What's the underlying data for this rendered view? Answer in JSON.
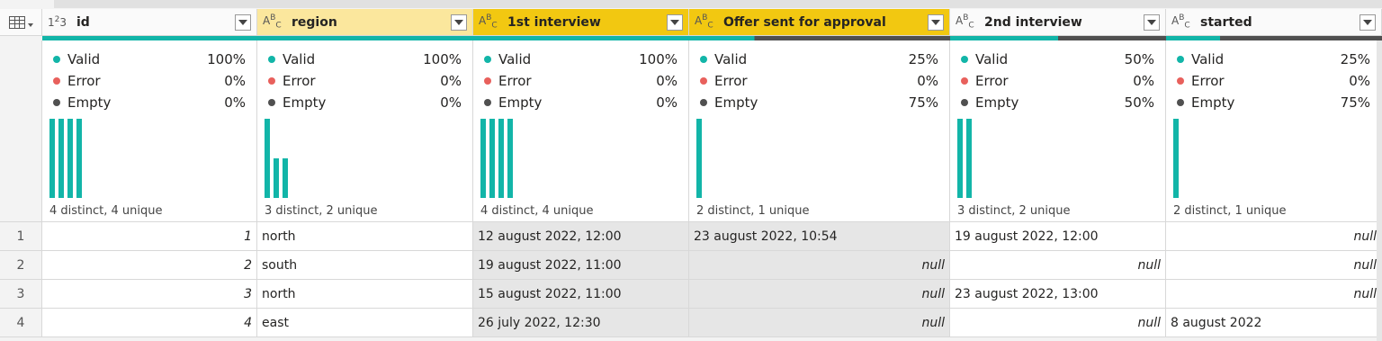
{
  "columns": [
    {
      "name": "id",
      "type": "123",
      "profile": {
        "valid": "100%",
        "error": "0%",
        "empty": "0%",
        "distinct": "4 distinct, 4 unique",
        "valid_fraction": 1.0
      }
    },
    {
      "name": "region",
      "type": "ABC",
      "profile": {
        "valid": "100%",
        "error": "0%",
        "empty": "0%",
        "distinct": "3 distinct, 2 unique",
        "valid_fraction": 1.0
      }
    },
    {
      "name": "1st interview",
      "type": "ABC",
      "profile": {
        "valid": "100%",
        "error": "0%",
        "empty": "0%",
        "distinct": "4 distinct, 4 unique",
        "valid_fraction": 1.0
      }
    },
    {
      "name": "Offer sent for approval",
      "type": "ABC",
      "profile": {
        "valid": "25%",
        "error": "0%",
        "empty": "75%",
        "distinct": "2 distinct, 1 unique",
        "valid_fraction": 0.25
      }
    },
    {
      "name": "2nd interview",
      "type": "ABC",
      "profile": {
        "valid": "50%",
        "error": "0%",
        "empty": "50%",
        "distinct": "3 distinct, 2 unique",
        "valid_fraction": 0.5
      }
    },
    {
      "name": "started",
      "type": "ABC",
      "profile": {
        "valid": "25%",
        "error": "0%",
        "empty": "75%",
        "distinct": "2 distinct, 1 unique",
        "valid_fraction": 0.25
      }
    }
  ],
  "labels": {
    "valid": "Valid",
    "error": "Error",
    "empty": "Empty"
  },
  "colors": {
    "valid": "#12b5a8",
    "error": "#e8605c",
    "empty": "#505050",
    "selected_header": "#f2c811",
    "hover_header": "#fbe79d"
  },
  "rows": [
    {
      "num": "1",
      "cells": [
        "1",
        "north",
        "12 august 2022, 12:00",
        "23 august 2022, 10:54",
        "19 august 2022, 12:00",
        "null"
      ]
    },
    {
      "num": "2",
      "cells": [
        "2",
        "south",
        "19 august 2022, 11:00",
        "null",
        "null",
        "null"
      ]
    },
    {
      "num": "3",
      "cells": [
        "3",
        "north",
        "15 august 2022, 11:00",
        "null",
        "23 august 2022, 13:00",
        "null"
      ]
    },
    {
      "num": "4",
      "cells": [
        "4",
        "east",
        "26 july 2022, 12:30",
        "null",
        "null",
        "8 august 2022"
      ]
    }
  ],
  "distribution": [
    [
      1,
      1,
      1,
      1
    ],
    [
      2,
      1,
      1
    ],
    [
      1,
      1,
      1,
      1
    ],
    [
      1
    ],
    [
      1,
      1
    ],
    [
      1
    ]
  ]
}
